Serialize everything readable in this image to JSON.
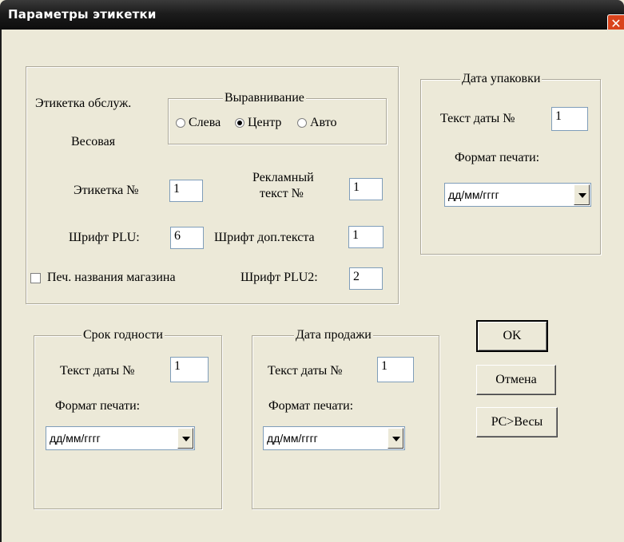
{
  "window": {
    "title": "Параметры этикетки",
    "close_glyph": "✕"
  },
  "label_group": {
    "service_label": "Этикетка обслуж.",
    "weight_type": "Весовая",
    "alignment": {
      "legend": "Выравнивание",
      "options": [
        "Слева",
        "Центр",
        "Авто"
      ],
      "selected": "Центр"
    },
    "label_no": {
      "label": "Этикетка №",
      "value": "1"
    },
    "ad_text": {
      "label_line1": "Рекламный",
      "label_line2": "текст №",
      "value": "1"
    },
    "font_plu": {
      "label": "Шрифт PLU:",
      "value": "6"
    },
    "font_extra": {
      "label": "Шрифт доп.текста",
      "value": "1"
    },
    "print_store": {
      "label": "Печ. названия магазина",
      "checked": false
    },
    "font_plu2": {
      "label": "Шрифт PLU2:",
      "value": "2"
    }
  },
  "pack_date": {
    "legend": "Дата упаковки",
    "text_label": "Текст даты №",
    "text_value": "1",
    "format_label": "Формат печати:",
    "format_value": "дд/мм/гггг"
  },
  "shelf_life": {
    "legend": "Срок годности",
    "text_label": "Текст даты №",
    "text_value": "1",
    "format_label": "Формат печати:",
    "format_value": "дд/мм/гггг"
  },
  "sale_date": {
    "legend": "Дата продажи",
    "text_label": "Текст даты №",
    "text_value": "1",
    "format_label": "Формат печати:",
    "format_value": "дд/мм/гггг"
  },
  "buttons": {
    "ok": "OK",
    "cancel": "Отмена",
    "pc_to_scale": "PC>Весы"
  }
}
